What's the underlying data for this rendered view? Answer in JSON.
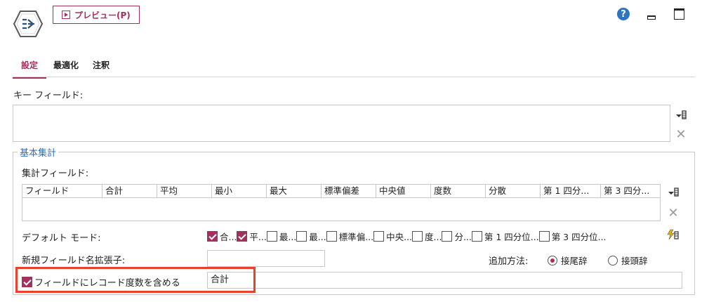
{
  "toolbar": {
    "preview_label": "プレビュー(P)"
  },
  "tabs": [
    {
      "label": "設定",
      "active": true
    },
    {
      "label": "最適化",
      "active": false
    },
    {
      "label": "注釈",
      "active": false
    }
  ],
  "key_fields": {
    "label": "キー フィールド:"
  },
  "basic_agg": {
    "legend": "基本集計",
    "agg_fields_label": "集計フィールド:",
    "columns": [
      "フィールド",
      "合計",
      "平均",
      "最小",
      "最大",
      "標準偏差",
      "中央値",
      "度数",
      "分散",
      "第 1 四分...",
      "第 3 四分..."
    ],
    "default_mode_label": "デフォルト モード:",
    "modes": [
      {
        "label": "合...",
        "checked": true
      },
      {
        "label": "平...",
        "checked": true
      },
      {
        "label": "最...",
        "checked": false
      },
      {
        "label": "最...",
        "checked": false
      },
      {
        "label": "標準偏...",
        "checked": false
      },
      {
        "label": "中央...",
        "checked": false
      },
      {
        "label": "度...",
        "checked": false
      },
      {
        "label": "分...",
        "checked": false
      },
      {
        "label": "第 1 四分位...",
        "checked": false
      },
      {
        "label": "第 3 四分位...",
        "checked": false
      }
    ],
    "suffix_label": "新規フィールド名拡張子:",
    "suffix_value": "",
    "add_method_label": "追加方法:",
    "add_options": [
      {
        "label": "接尾辞",
        "selected": true
      },
      {
        "label": "接頭辞",
        "selected": false
      }
    ],
    "include_count": {
      "label": "フィールドにレコード度数を含める",
      "checked": true,
      "value": "合計"
    }
  },
  "colors": {
    "accent": "#a3305e",
    "legend": "#2f6fb0",
    "highlight": "#e8412c",
    "help": "#2f74c0"
  },
  "icons": [
    "node-icon",
    "help-icon",
    "minimize-icon",
    "maximize-icon",
    "field-picker-icon",
    "delete-icon",
    "auto-mode-icon"
  ]
}
